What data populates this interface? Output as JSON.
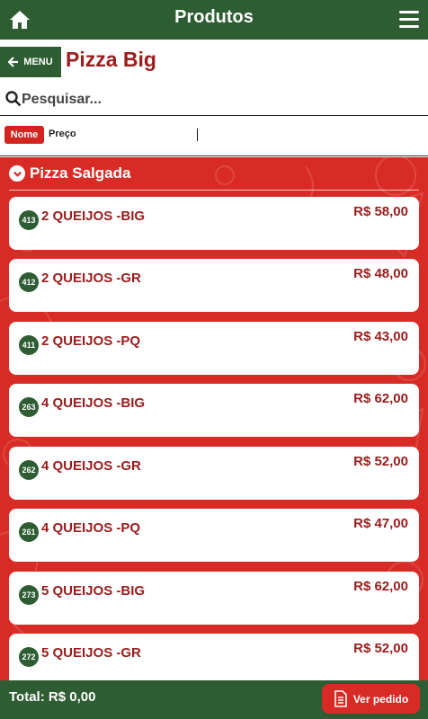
{
  "header": {
    "title": "Produtos",
    "home_icon": "home-icon",
    "menu_icon": "hamburger-menu-icon"
  },
  "category": {
    "back_label": "MENU",
    "title": "Pizza Big"
  },
  "search": {
    "placeholder": "Pesquisar...",
    "value": ""
  },
  "sort": {
    "options": [
      "Nome",
      "Preço"
    ],
    "active": "Nome"
  },
  "group": {
    "title": "Pizza Salgada"
  },
  "products": [
    {
      "code": "413",
      "name": "2 QUEIJOS -BIG",
      "price": "R$ 58,00"
    },
    {
      "code": "412",
      "name": "2 QUEIJOS -GR",
      "price": "R$ 48,00"
    },
    {
      "code": "411",
      "name": "2 QUEIJOS -PQ",
      "price": "R$ 43,00"
    },
    {
      "code": "263",
      "name": "4 QUEIJOS -BIG",
      "price": "R$ 62,00"
    },
    {
      "code": "262",
      "name": "4 QUEIJOS -GR",
      "price": "R$ 52,00"
    },
    {
      "code": "261",
      "name": "4 QUEIJOS -PQ",
      "price": "R$ 47,00"
    },
    {
      "code": "273",
      "name": "5 QUEIJOS -BIG",
      "price": "R$ 62,00"
    },
    {
      "code": "272",
      "name": "5 QUEIJOS -GR",
      "price": "R$ 52,00"
    }
  ],
  "footer": {
    "total": "Total: R$ 0,00",
    "order_label": "Ver pedido"
  },
  "colors": {
    "green": "#2e5d33",
    "red": "#d92b25",
    "dark_red_text": "#9b1c1c"
  }
}
